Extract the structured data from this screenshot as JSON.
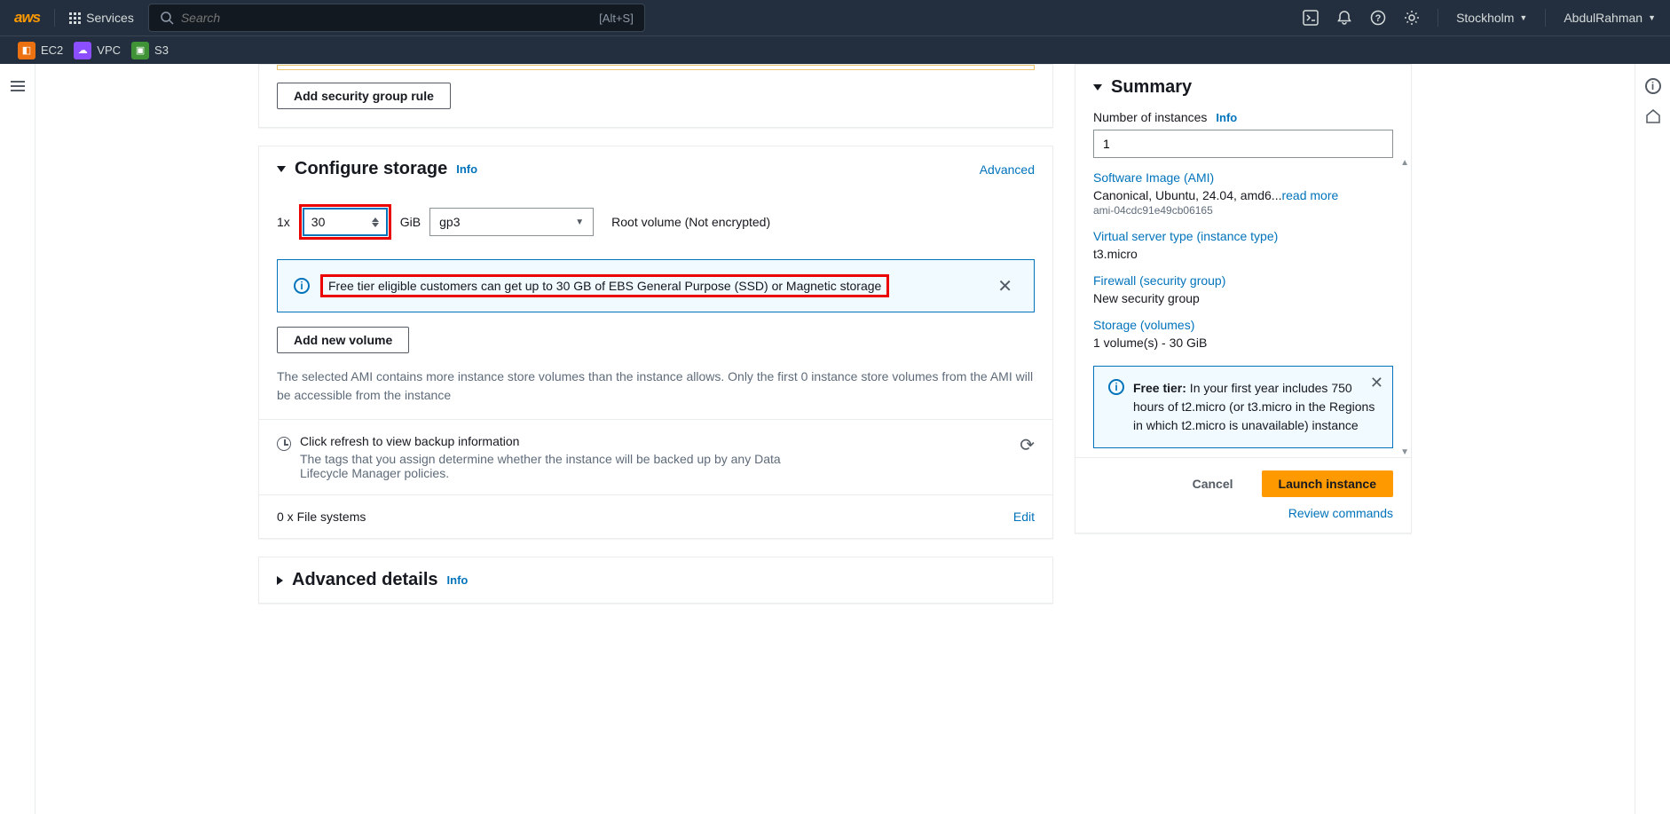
{
  "topnav": {
    "logo": "aws",
    "services": "Services",
    "search_placeholder": "Search",
    "search_hint": "[Alt+S]",
    "region": "Stockholm",
    "user": "AbdulRahman"
  },
  "favorites": [
    {
      "label": "EC2"
    },
    {
      "label": "VPC"
    },
    {
      "label": "S3"
    }
  ],
  "sg_panel": {
    "add_rule_btn": "Add security group rule"
  },
  "storage_panel": {
    "title": "Configure storage",
    "info": "Info",
    "advanced": "Advanced",
    "count_prefix": "1x",
    "size_value": "30",
    "unit": "GiB",
    "vol_type": "gp3",
    "root_desc": "Root volume  (Not encrypted)",
    "free_tier_msg": "Free tier eligible customers can get up to 30 GB of EBS General Purpose (SSD) or Magnetic storage",
    "add_volume_btn": "Add new volume",
    "ami_note": "The selected AMI contains more instance store volumes than the instance allows. Only the first 0 instance store volumes from the AMI will be accessible from the instance",
    "backup_title": "Click refresh to view backup information",
    "backup_desc": "The tags that you assign determine whether the instance will be backed up by any Data Lifecycle Manager policies.",
    "fs": "0 x File systems",
    "edit": "Edit"
  },
  "advanced_panel": {
    "title": "Advanced details",
    "info": "Info"
  },
  "summary": {
    "title": "Summary",
    "num_label": "Number of instances",
    "info": "Info",
    "num_value": "1",
    "ami_label": "Software Image (AMI)",
    "ami_value": "Canonical, Ubuntu, 24.04, amd6...",
    "read_more": "read more",
    "ami_id": "ami-04cdc91e49cb06165",
    "type_label": "Virtual server type (instance type)",
    "type_value": "t3.micro",
    "sg_label": "Firewall (security group)",
    "sg_value": "New security group",
    "storage_label": "Storage (volumes)",
    "storage_value": "1 volume(s) - 30 GiB",
    "free_tier_bold": "Free tier:",
    "free_tier_text": " In your first year includes 750 hours of t2.micro (or t3.micro in the Regions in which t2.micro is unavailable) instance",
    "cancel": "Cancel",
    "launch": "Launch instance",
    "review_cmds": "Review commands"
  }
}
